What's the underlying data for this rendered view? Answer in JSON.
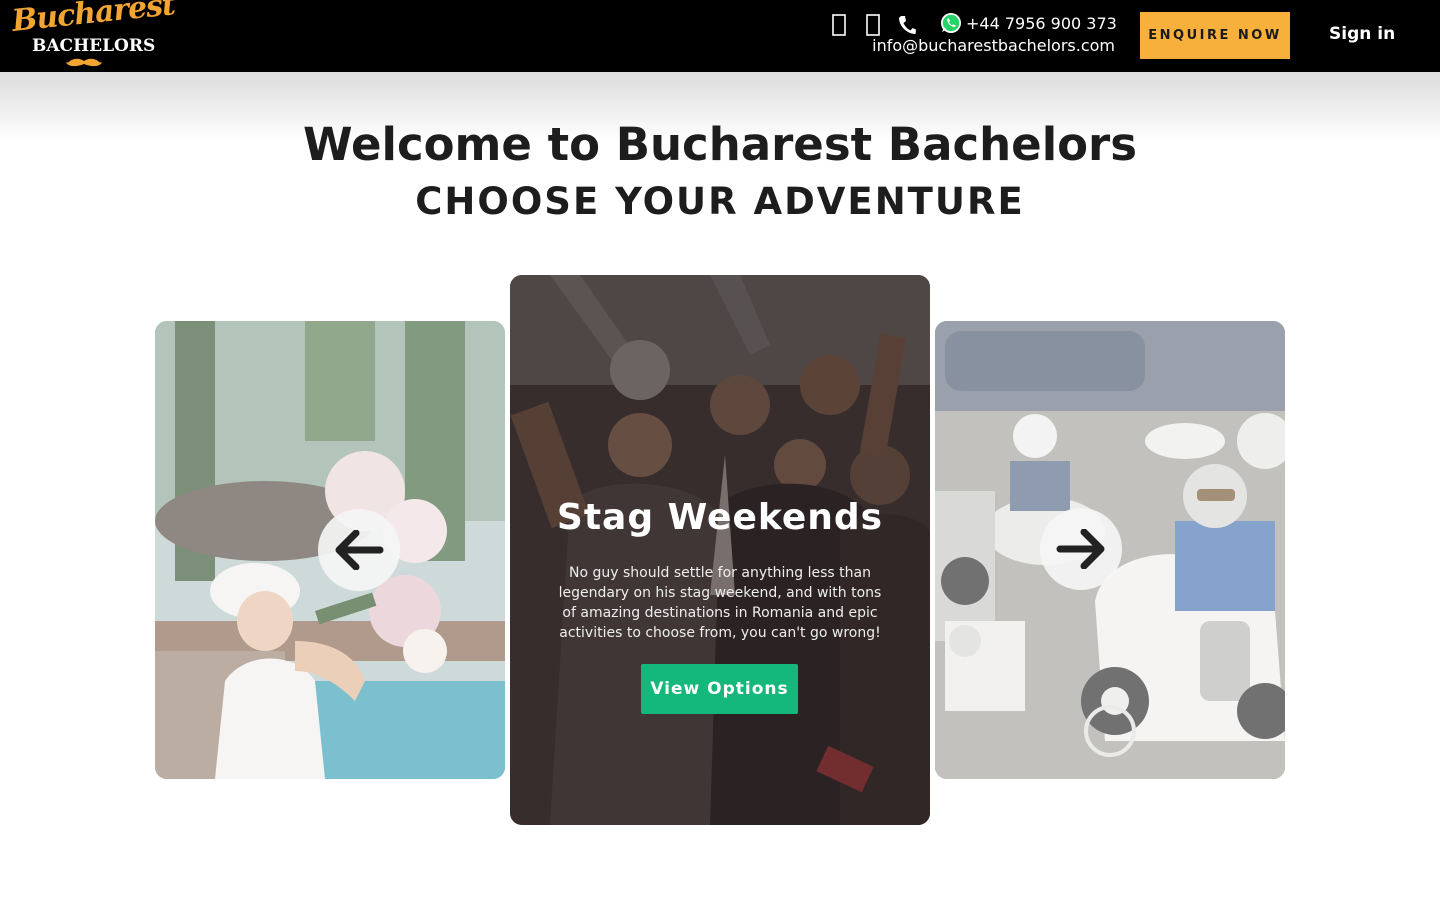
{
  "header": {
    "logo_script": "Bucharest",
    "logo_block": "BACHELORS",
    "social_icons": [
      "facebook-icon",
      "instagram-icon"
    ],
    "phone_icon": "phone-icon",
    "whatsapp_icon": "whatsapp-icon",
    "phone": "+44 7956 900 373",
    "email": "info@bucharestbachelors.com",
    "enquire_label": "ENQUIRE NOW",
    "signin_label": "Sign in"
  },
  "hero": {
    "welcome": "Welcome to Bucharest Bachelors",
    "tagline": "CHOOSE YOUR ADVENTURE"
  },
  "carousel": {
    "active": {
      "title": "Stag Weekends",
      "text": "No guy should settle for anything less than legendary on his stag weekend, and with tons of amazing destinations in Romania and epic activities to choose from, you can't go wrong!",
      "button_label": "View Options"
    },
    "prev_icon": "arrow-left-icon",
    "next_icon": "arrow-right-icon"
  },
  "colors": {
    "accent": "#f7b03c",
    "button_green": "#14b87a",
    "header_bg": "#000000"
  }
}
